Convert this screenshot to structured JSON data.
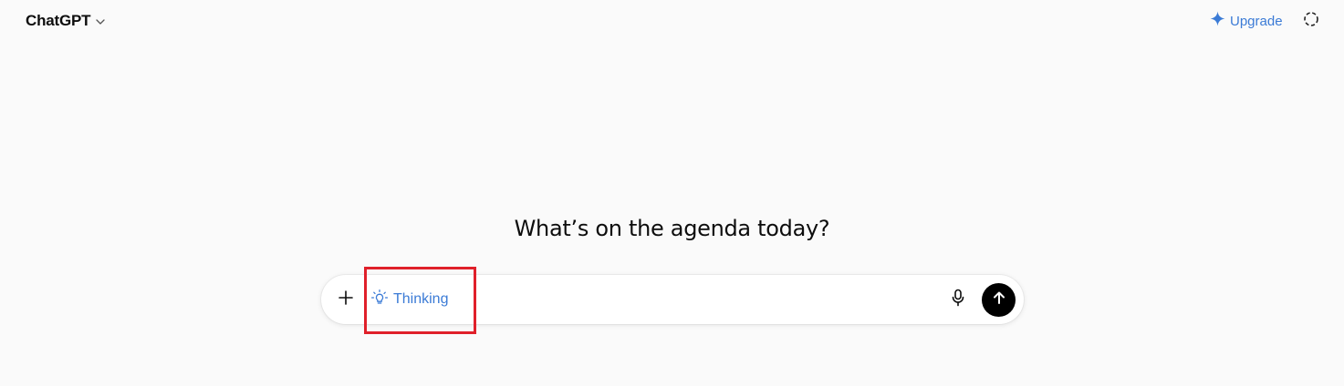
{
  "header": {
    "model_name": "ChatGPT",
    "model_chevron_icon": "chevron-down-icon",
    "upgrade_label": "Upgrade",
    "upgrade_icon": "sparkle-icon",
    "temporary_chat_icon": "temporary-chat-icon"
  },
  "main": {
    "headline": "What’s on the agenda today?"
  },
  "composer": {
    "placeholder": "",
    "attach_icon": "plus-icon",
    "tool_chip": {
      "label": "Thinking",
      "icon": "lightbulb-icon"
    },
    "mic_icon": "microphone-icon",
    "send_icon": "arrow-up-icon"
  },
  "colors": {
    "background": "#fafafa",
    "accent": "#3b7bd6",
    "send_button": "#000000",
    "highlight": "#e0202a"
  }
}
